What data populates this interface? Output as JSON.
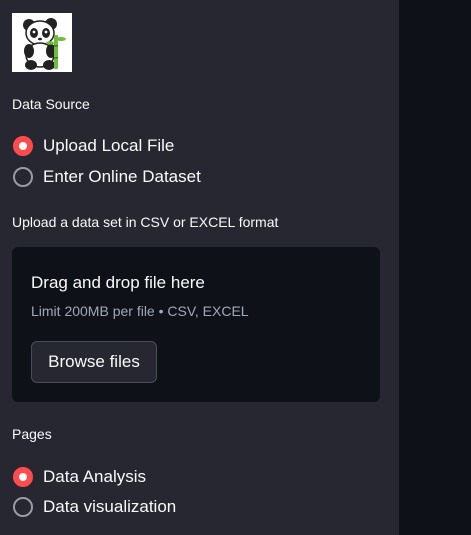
{
  "logo": {
    "icon": "panda-icon"
  },
  "data_source": {
    "label": "Data Source",
    "options": [
      {
        "label": "Upload Local File",
        "selected": true
      },
      {
        "label": "Enter Online Dataset",
        "selected": false
      }
    ]
  },
  "uploader": {
    "label": "Upload a data set in CSV or EXCEL format",
    "title": "Drag and drop file here",
    "subtitle": "Limit 200MB per file • CSV, EXCEL",
    "button_label": "Browse files"
  },
  "pages": {
    "label": "Pages",
    "options": [
      {
        "label": "Data Analysis",
        "selected": true
      },
      {
        "label": "Data visualization",
        "selected": false
      }
    ]
  },
  "colors": {
    "sidebar_bg": "#262730",
    "main_bg": "#0e1117",
    "accent": "#ff4b4b",
    "text": "#fafafa",
    "muted_text": "#a3a8b8"
  }
}
